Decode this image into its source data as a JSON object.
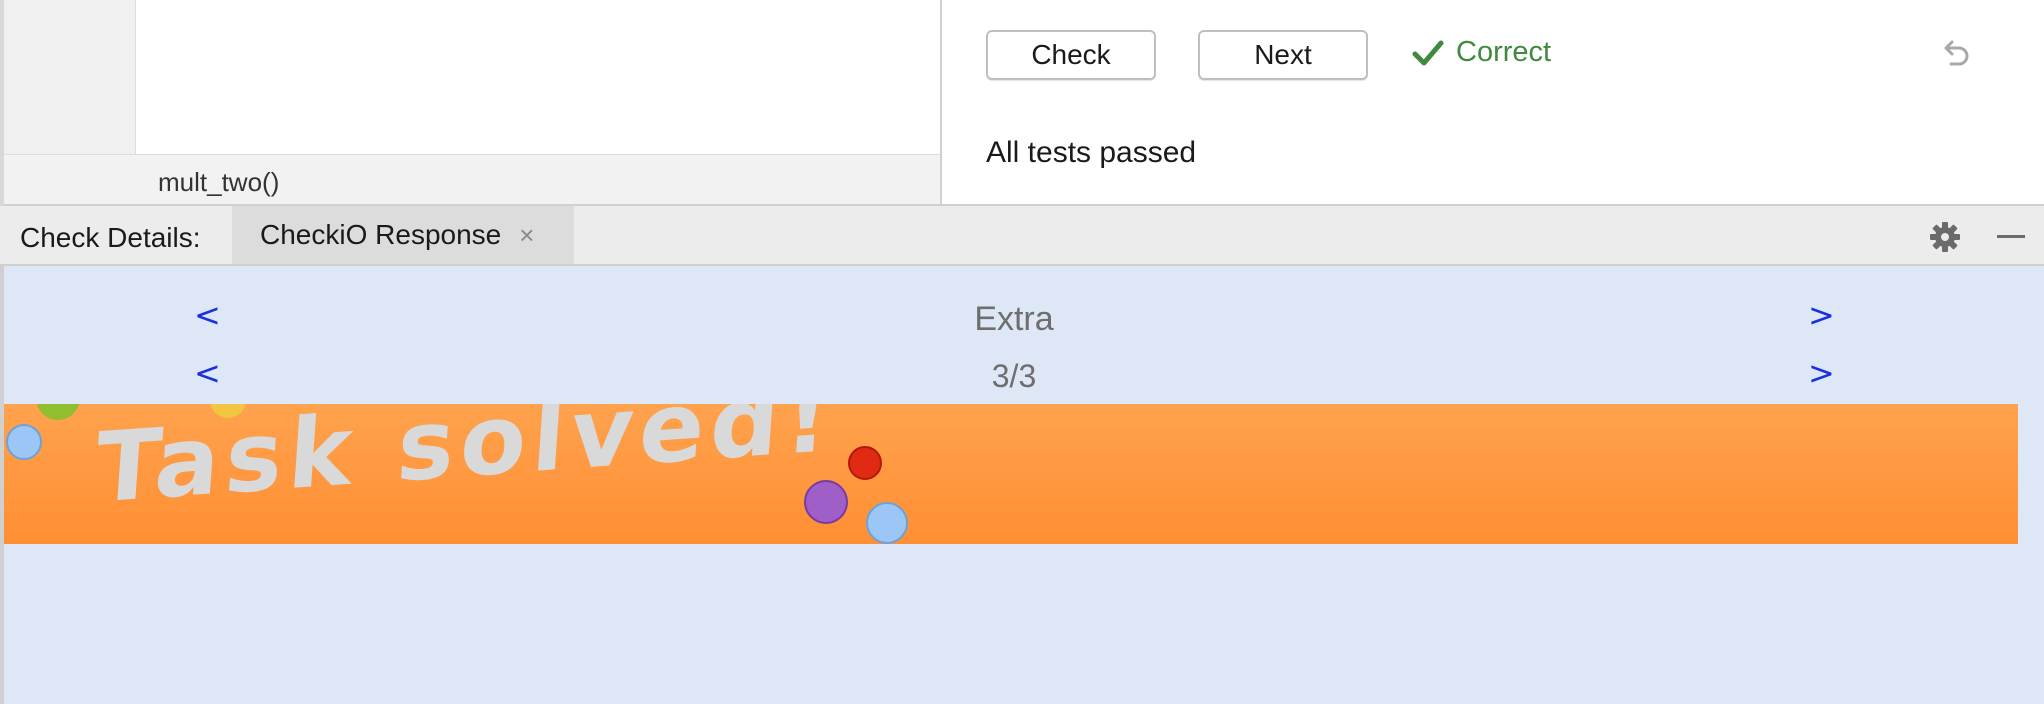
{
  "editor": {
    "breadcrumb": "mult_two()"
  },
  "task_panel": {
    "check_label": "Check",
    "next_label": "Next",
    "status_text": "Correct",
    "result_message": "All tests passed"
  },
  "tool_window": {
    "title": "Check Details:",
    "tab_label": "CheckiO Response",
    "tab_close": "×"
  },
  "response": {
    "category_nav": {
      "prev": "<",
      "label": "Extra",
      "next": ">"
    },
    "index_nav": {
      "prev": "<",
      "label": "3/3",
      "next": ">"
    },
    "banner_text": "Task solved!"
  },
  "colors": {
    "status_green": "#3f8a3f",
    "nav_blue": "#1b2fe0",
    "content_bg": "#dde7f6",
    "banner_orange": "#ff9a3f"
  },
  "icons": [
    "check-icon",
    "undo-icon",
    "close-icon",
    "gear-icon",
    "minimize-icon"
  ]
}
